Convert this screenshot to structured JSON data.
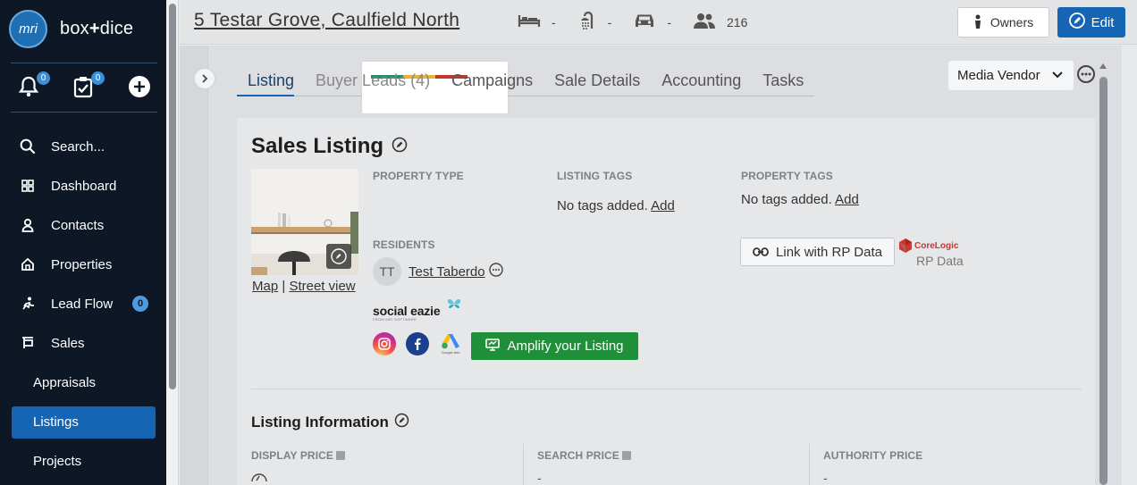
{
  "brand": {
    "logo_text": "mri",
    "name_left": "box",
    "name_plus": "+",
    "name_right": "dice"
  },
  "quick": {
    "notifications_count": "0",
    "tasks_count": "0"
  },
  "nav": {
    "search": "Search...",
    "dashboard": "Dashboard",
    "contacts": "Contacts",
    "properties": "Properties",
    "lead_flow": "Lead Flow",
    "lead_flow_count": "0",
    "sales": "Sales",
    "appraisals": "Appraisals",
    "listings": "Listings",
    "projects": "Projects"
  },
  "header": {
    "address": "5 Testar Grove, Caulfield North",
    "beds": "-",
    "baths": "-",
    "cars": "-",
    "contacts_count": "216",
    "owners_label": "Owners",
    "edit_label": "Edit"
  },
  "tabs": [
    {
      "label": "Listing"
    },
    {
      "label": "Buyer Leads (4)"
    },
    {
      "label": "Campaigns"
    },
    {
      "label": "Sale Details"
    },
    {
      "label": "Accounting"
    },
    {
      "label": "Tasks"
    }
  ],
  "lead_bar_colors": [
    "#1e8f6f",
    "#e8b23a",
    "#c0392b"
  ],
  "media_vendor": "Media Vendor",
  "listing": {
    "title": "Sales Listing",
    "property_type_label": "PROPERTY TYPE",
    "listing_tags_label": "LISTING TAGS",
    "listing_tags_empty": "No tags added.",
    "listing_tags_add": "Add",
    "property_tags_label": "PROPERTY TAGS",
    "property_tags_empty": "No tags added.",
    "property_tags_add": "Add",
    "residents_label": "RESIDENTS",
    "resident_initials": "TT",
    "resident_name": "Test Taberdo",
    "map_link": "Map",
    "link_sep": "|",
    "street_view_link": "Street view",
    "rp_button": "Link with RP Data",
    "corelogic_top": "CoreLogic",
    "corelogic_bottom": "RP Data",
    "social_eazie": "social eazie",
    "social_eazie_sub": "FROM MRI SOFTWARE",
    "google_ads_caption": "Google Ads",
    "amplify_button": "Amplify your Listing"
  },
  "info": {
    "title": "Listing Information",
    "display_price_label": "DISPLAY PRICE",
    "search_price_label": "SEARCH PRICE",
    "search_price_value": "-",
    "authority_price_label": "AUTHORITY PRICE",
    "authority_price_value": "-"
  }
}
